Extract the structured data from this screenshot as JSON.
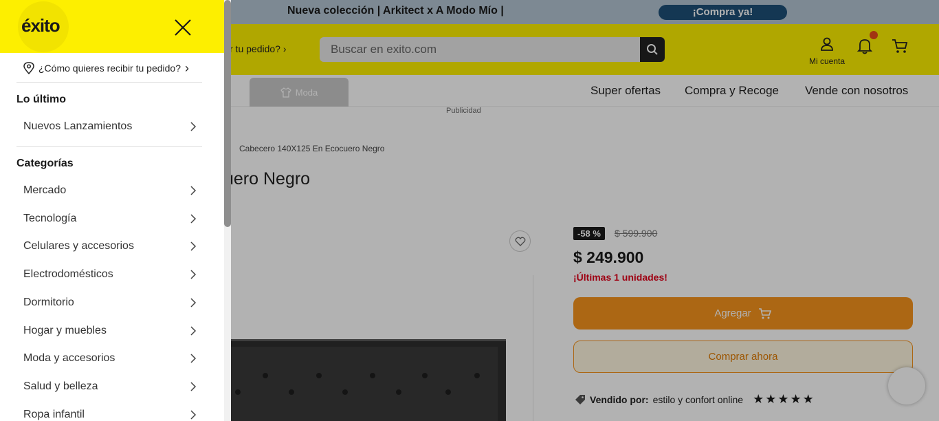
{
  "promo": {
    "text": "Nueva colección | Arkitect x A Modo Mío |",
    "cta": "¡Compra ya!"
  },
  "header": {
    "delivery_prompt": "ibir tu pedido?",
    "search_placeholder": "Buscar en exito.com",
    "account_label": "Mi cuenta"
  },
  "nav": {
    "active_tab": "Moda",
    "links": [
      "Super ofertas",
      "Compra y Recoge",
      "Vende con nosotros"
    ]
  },
  "ad_label": "Publicidad",
  "breadcrumb": "Cabecero 140X125 En Ecocuero Negro",
  "product": {
    "title_visible": "uero Negro",
    "discount": "-58 %",
    "old_price": "$ 599.900",
    "price": "$ 249.900",
    "stock_note": "¡Últimas 1 unidades!",
    "add_label": "Agregar",
    "buy_now_label": "Comprar ahora",
    "seller_prefix": "Vendido por:",
    "seller_name": "estilo y confort online",
    "rating": 5
  },
  "drawer": {
    "logo": "éxito",
    "delivery_prompt": "¿Cómo quieres recibir tu pedido?",
    "latest_title": "Lo último",
    "latest_items": [
      "Nuevos Lanzamientos"
    ],
    "categories_title": "Categorías",
    "categories": [
      "Mercado",
      "Tecnología",
      "Celulares y accesorios",
      "Electrodomésticos",
      "Dormitorio",
      "Hogar y muebles",
      "Moda y accesorios",
      "Salud y belleza",
      "Ropa infantil"
    ]
  },
  "colors": {
    "brand_yellow": "#fdef00",
    "promo_blue": "#1d4f77",
    "add_orange": "#f7941d",
    "alert_red": "#e2001a"
  }
}
